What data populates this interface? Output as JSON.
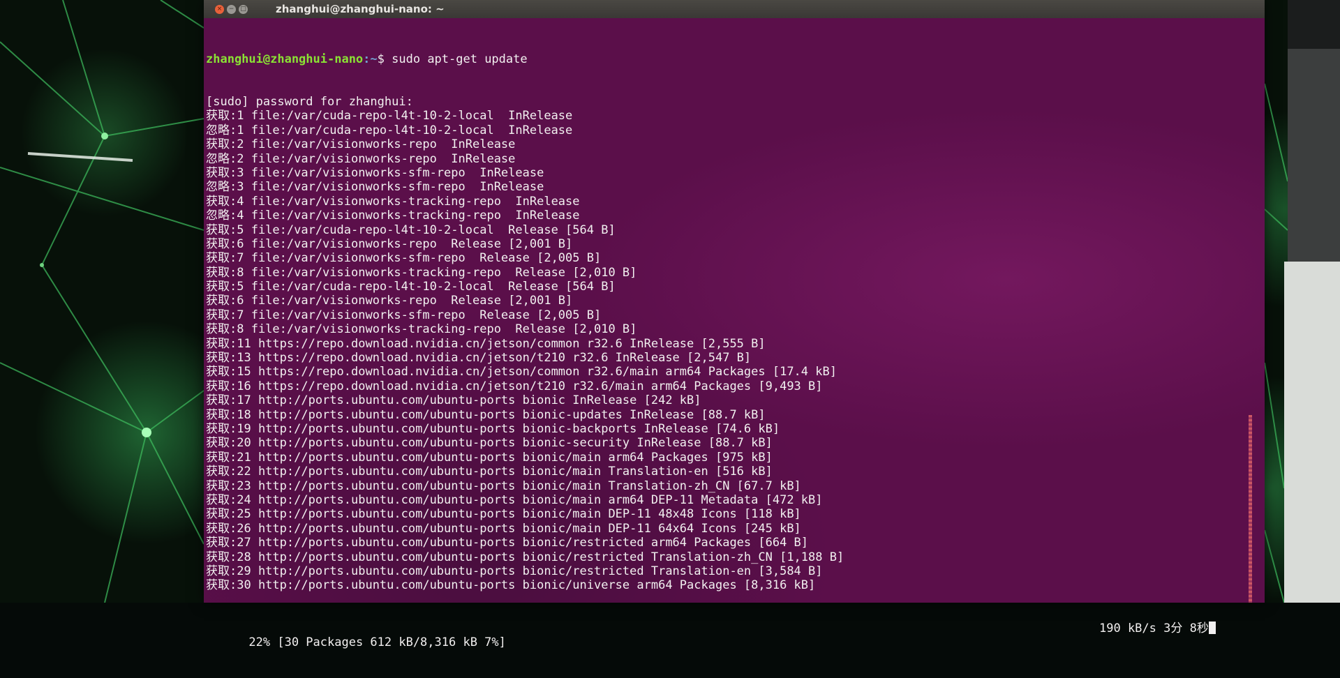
{
  "window": {
    "title": "zhanghui@zhanghui-nano: ~",
    "buttons": {
      "close": "×",
      "minimize": "−",
      "maximize": "□"
    }
  },
  "terminal": {
    "prompt": {
      "user_host": "zhanghui@zhanghui-nano",
      "path": ":~",
      "symbol": "$ ",
      "command": "sudo apt-get update"
    },
    "lines": [
      "[sudo] password for zhanghui:",
      "获取:1 file:/var/cuda-repo-l4t-10-2-local  InRelease",
      "忽略:1 file:/var/cuda-repo-l4t-10-2-local  InRelease",
      "获取:2 file:/var/visionworks-repo  InRelease",
      "忽略:2 file:/var/visionworks-repo  InRelease",
      "获取:3 file:/var/visionworks-sfm-repo  InRelease",
      "忽略:3 file:/var/visionworks-sfm-repo  InRelease",
      "获取:4 file:/var/visionworks-tracking-repo  InRelease",
      "忽略:4 file:/var/visionworks-tracking-repo  InRelease",
      "获取:5 file:/var/cuda-repo-l4t-10-2-local  Release [564 B]",
      "获取:6 file:/var/visionworks-repo  Release [2,001 B]",
      "获取:7 file:/var/visionworks-sfm-repo  Release [2,005 B]",
      "获取:8 file:/var/visionworks-tracking-repo  Release [2,010 B]",
      "获取:5 file:/var/cuda-repo-l4t-10-2-local  Release [564 B]",
      "获取:6 file:/var/visionworks-repo  Release [2,001 B]",
      "获取:7 file:/var/visionworks-sfm-repo  Release [2,005 B]",
      "获取:8 file:/var/visionworks-tracking-repo  Release [2,010 B]",
      "获取:11 https://repo.download.nvidia.cn/jetson/common r32.6 InRelease [2,555 B]",
      "获取:13 https://repo.download.nvidia.cn/jetson/t210 r32.6 InRelease [2,547 B]",
      "获取:15 https://repo.download.nvidia.cn/jetson/common r32.6/main arm64 Packages [17.4 kB]",
      "获取:16 https://repo.download.nvidia.cn/jetson/t210 r32.6/main arm64 Packages [9,493 B]",
      "获取:17 http://ports.ubuntu.com/ubuntu-ports bionic InRelease [242 kB]",
      "获取:18 http://ports.ubuntu.com/ubuntu-ports bionic-updates InRelease [88.7 kB]",
      "获取:19 http://ports.ubuntu.com/ubuntu-ports bionic-backports InRelease [74.6 kB]",
      "获取:20 http://ports.ubuntu.com/ubuntu-ports bionic-security InRelease [88.7 kB]",
      "获取:21 http://ports.ubuntu.com/ubuntu-ports bionic/main arm64 Packages [975 kB]",
      "获取:22 http://ports.ubuntu.com/ubuntu-ports bionic/main Translation-en [516 kB]",
      "获取:23 http://ports.ubuntu.com/ubuntu-ports bionic/main Translation-zh_CN [67.7 kB]",
      "获取:24 http://ports.ubuntu.com/ubuntu-ports bionic/main arm64 DEP-11 Metadata [472 kB]",
      "获取:25 http://ports.ubuntu.com/ubuntu-ports bionic/main DEP-11 48x48 Icons [118 kB]",
      "获取:26 http://ports.ubuntu.com/ubuntu-ports bionic/main DEP-11 64x64 Icons [245 kB]",
      "获取:27 http://ports.ubuntu.com/ubuntu-ports bionic/restricted arm64 Packages [664 B]",
      "获取:28 http://ports.ubuntu.com/ubuntu-ports bionic/restricted Translation-zh_CN [1,188 B]",
      "获取:29 http://ports.ubuntu.com/ubuntu-ports bionic/restricted Translation-en [3,584 B]",
      "获取:30 http://ports.ubuntu.com/ubuntu-ports bionic/universe arm64 Packages [8,316 kB]"
    ],
    "status": {
      "progress": "22% [30 Packages 612 kB/8,316 kB 7%]",
      "rate_eta": "190 kB/s 3分 8秒"
    }
  },
  "colors": {
    "terminal_bg": "#5b0f4a",
    "prompt_user": "#8ae234",
    "prompt_path": "#729fcf",
    "text": "#f2f0f0",
    "titlebar": "#3a3835",
    "close_button": "#e8613a"
  }
}
